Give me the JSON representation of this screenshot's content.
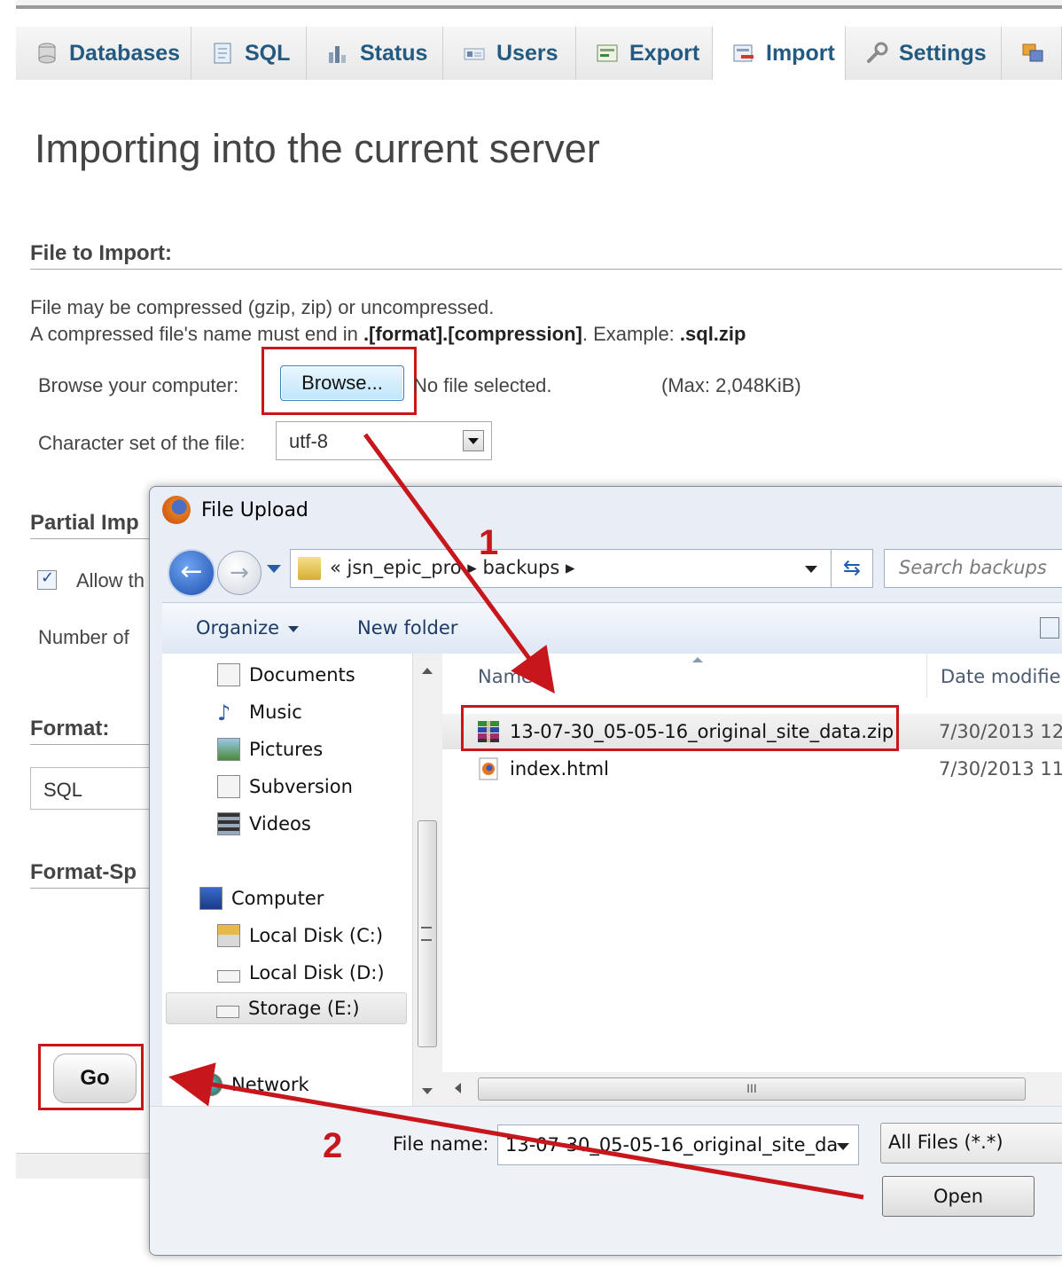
{
  "tabs": [
    {
      "label": "Databases",
      "icon": "database-icon"
    },
    {
      "label": "SQL",
      "icon": "sql-icon"
    },
    {
      "label": "Status",
      "icon": "status-chart-icon"
    },
    {
      "label": "Users",
      "icon": "users-icon"
    },
    {
      "label": "Export",
      "icon": "export-icon"
    },
    {
      "label": "Import",
      "icon": "import-icon",
      "active": true
    },
    {
      "label": "Settings",
      "icon": "wrench-icon"
    }
  ],
  "page": {
    "title": "Importing into the current server",
    "file_section": "File to Import:",
    "compress_note_1": "File may be compressed (gzip, zip) or uncompressed.",
    "compress_note_2a": "A compressed file's name must end in ",
    "compress_note_2b": ".[format].[compression]",
    "compress_note_2c": ". Example: ",
    "compress_note_2d": ".sql.zip",
    "browse_label": "Browse your computer:",
    "browse_button": "Browse...",
    "no_file": "No file selected.",
    "max_size": "(Max: 2,048KiB)",
    "charset_label": "Character set of the file:",
    "charset_value": "utf-8",
    "partial_section": "Partial Imp",
    "allow_label": "Allow th",
    "number_label": "Number of",
    "format_section": "Format:",
    "format_value": "SQL",
    "format_specific": "Format-Sp",
    "go_button": "Go"
  },
  "dialog": {
    "title": "File Upload",
    "breadcrumb": "« jsn_epic_pro ▸ backups ▸",
    "search_placeholder": "Search backups",
    "organize": "Organize",
    "new_folder": "New folder",
    "nav": [
      {
        "label": "Documents",
        "icon": "documents-icon"
      },
      {
        "label": "Music",
        "icon": "music-icon"
      },
      {
        "label": "Pictures",
        "icon": "pictures-icon"
      },
      {
        "label": "Subversion",
        "icon": "subversion-icon"
      },
      {
        "label": "Videos",
        "icon": "videos-icon"
      },
      {
        "label": "Computer",
        "icon": "computer-icon"
      },
      {
        "label": "Local Disk (C:)",
        "icon": "disk-icon"
      },
      {
        "label": "Local Disk (D:)",
        "icon": "disk-icon"
      },
      {
        "label": "Storage (E:)",
        "icon": "disk-icon",
        "selected": true
      },
      {
        "label": "Network",
        "icon": "network-icon"
      }
    ],
    "columns": {
      "name": "Name",
      "date": "Date modifie"
    },
    "files": [
      {
        "name": "13-07-30_05-05-16_original_site_data.zip",
        "date": "7/30/2013 12",
        "icon": "zip-archive-icon",
        "highlighted": true
      },
      {
        "name": "index.html",
        "date": "7/30/2013 11",
        "icon": "firefox-html-icon"
      }
    ],
    "hscroll_grip": "III",
    "file_name_label": "File name:",
    "file_name_value": "13-07-30_05-05-16_original_site_da",
    "filter": "All Files (*.*)",
    "open_button": "Open"
  },
  "annotations": {
    "step1": "1",
    "step2": "2",
    "color": "#c8161d"
  }
}
